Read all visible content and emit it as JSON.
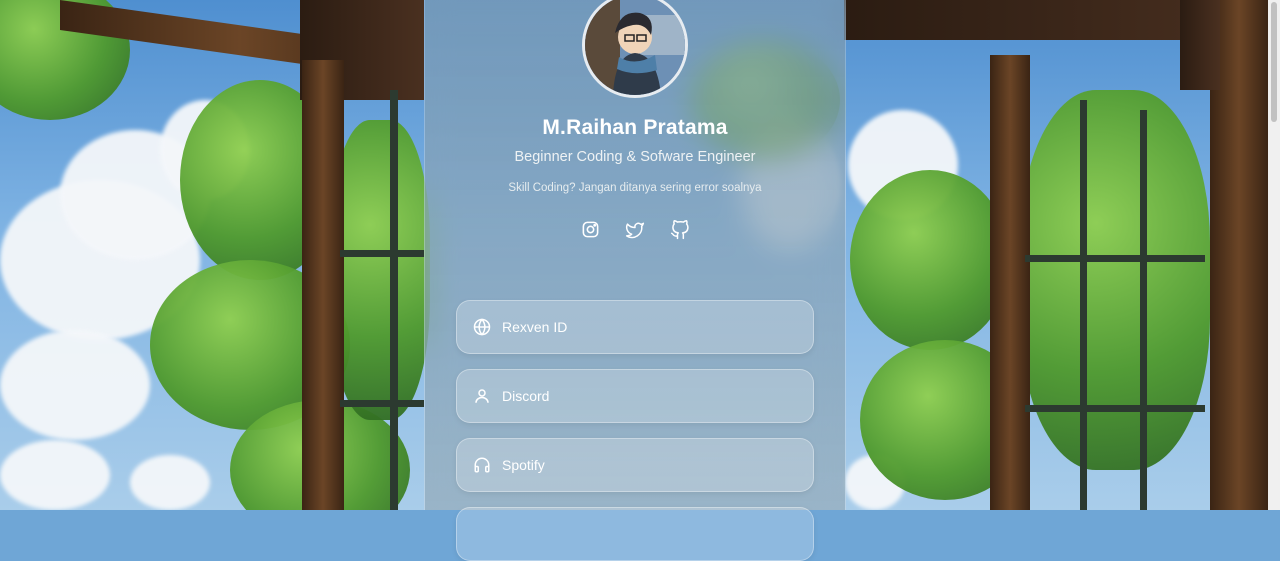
{
  "profile": {
    "name": "M.Raihan Pratama",
    "role": "Beginner Coding & Sofware Engineer",
    "bio": "Skill Coding? Jangan ditanya sering error soalnya"
  },
  "socials": [
    {
      "icon": "instagram-icon"
    },
    {
      "icon": "twitter-icon"
    },
    {
      "icon": "github-icon"
    }
  ],
  "links": [
    {
      "label": "Rexven ID",
      "icon": "globe-icon"
    },
    {
      "label": "Discord",
      "icon": "user-icon"
    },
    {
      "label": "Spotify",
      "icon": "headphones-icon"
    }
  ]
}
